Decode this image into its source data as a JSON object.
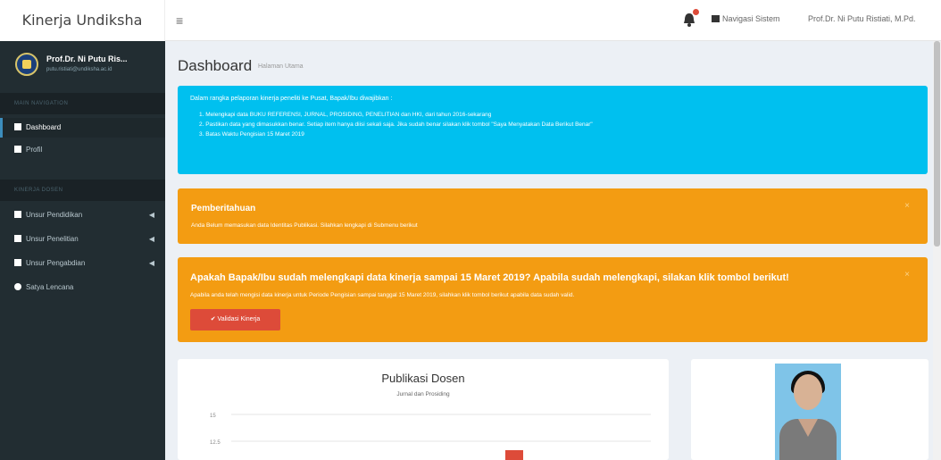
{
  "header": {
    "logo": "Kinerja Undiksha",
    "menu_icon": "bars-icon",
    "nav_sistem": "Navigasi Sistem",
    "nav_user": "Prof.Dr. Ni Putu Ristiati, M.Pd."
  },
  "sidebar": {
    "user_name": "Prof.Dr. Ni Putu Ris...",
    "user_email": "putu.ristiati@undiksha.ac.id",
    "header_main": "MAIN NAVIGATION",
    "items_main": [
      {
        "label": "Dashboard",
        "icon": "home-icon"
      },
      {
        "label": "Profil",
        "icon": "user-icon"
      }
    ],
    "header_kinerja": "KINERJA DOSEN",
    "items_kinerja": [
      {
        "label": "Unsur Pendidikan",
        "icon": "graduation-cap-icon"
      },
      {
        "label": "Unsur Penelitian",
        "icon": "book-icon"
      },
      {
        "label": "Unsur Pengabdian",
        "icon": "person-icon"
      },
      {
        "label": "Satya Lencana",
        "icon": "circle-icon"
      }
    ]
  },
  "page": {
    "title": "Dashboard",
    "subtitle": "Halaman Utama"
  },
  "info": {
    "intro": "Dalam rangka pelaporan kinerja peneliti ke Pusat, Bapak/Ibu diwajibkan :",
    "items": [
      "1. Melengkapi data BUKU REFERENSI, JURNAL, PROSIDING, PENELITIAN dan HKI, dari tahun 2016-sekarang",
      "2. Pastikan data yang dimasukkan benar. Setiap item hanya diisi sekali saja. Jika sudah benar silakan klik tombol \"Saya Menyatakan Data Berikut Benar\"",
      "3. Batas Waktu Pengisian 15 Maret 2019"
    ]
  },
  "notice": {
    "title": "Pemberitahuan",
    "text": "Anda Belum memasukan data Identitas Publikasi. Silahkan lengkapi di Submenu berikut"
  },
  "confirm": {
    "title": "Apakah Bapak/Ibu sudah melengkapi data kinerja sampai 15 Maret 2019? Apabila sudah melengkapi, silakan klik tombol berikut!",
    "text": "Apabila anda telah mengisi data kinerja untuk Periode Pengisian sampai tanggal 15 Maret 2019, silahkan klik tombol berikut apabila data sudah valid.",
    "button": "Validasi Kinerja"
  },
  "chart_data": {
    "type": "bar",
    "title": "Publikasi Dosen",
    "subtitle": "Jurnal dan Prosiding",
    "ytick_labels": [
      "15",
      "12.5"
    ],
    "ylim": [
      12.5,
      15
    ]
  }
}
